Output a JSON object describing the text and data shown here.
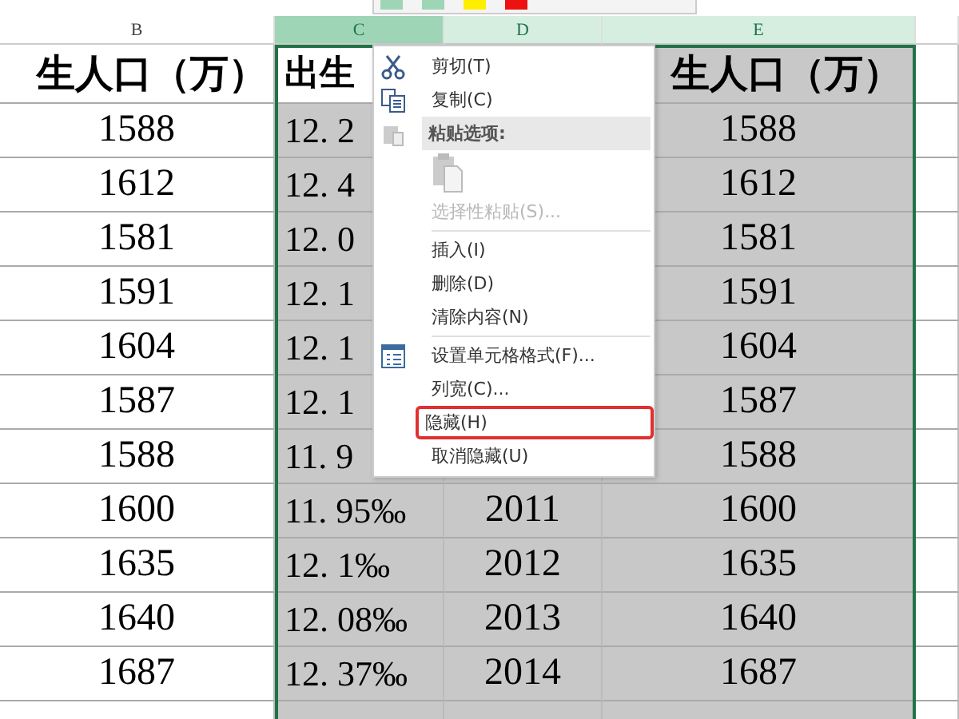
{
  "columns": [
    {
      "label": "B",
      "selected": false,
      "active": false
    },
    {
      "label": "C",
      "selected": true,
      "active": true
    },
    {
      "label": "D",
      "selected": true,
      "active": false
    },
    {
      "label": "E",
      "selected": true,
      "active": false
    }
  ],
  "title_row": {
    "B": "生人口（万）",
    "C": "出生",
    "E": "生人口（万）"
  },
  "rows": [
    {
      "B": "1588",
      "C": "12. 2",
      "E": "1588"
    },
    {
      "B": "1612",
      "C": "12. 4",
      "E": "1612"
    },
    {
      "B": "1581",
      "C": "12. 0",
      "E": "1581"
    },
    {
      "B": "1591",
      "C": "12. 1",
      "E": "1591"
    },
    {
      "B": "1604",
      "C": "12. 1",
      "E": "1604"
    },
    {
      "B": "1587",
      "C": "12. 1",
      "E": "1587"
    },
    {
      "B": "1588",
      "C": "11. 9",
      "E": "1588"
    },
    {
      "B": "1600",
      "C": "11. 95‰",
      "D": "2011",
      "E": "1600"
    },
    {
      "B": "1635",
      "C": "12. 1‰",
      "D": "2012",
      "E": "1635"
    },
    {
      "B": "1640",
      "C": "12. 08‰",
      "D": "2013",
      "E": "1640"
    },
    {
      "B": "1687",
      "C": "12. 37‰",
      "D": "2014",
      "E": "1687"
    }
  ],
  "context_menu": [
    {
      "kind": "command",
      "label": "剪切(T)",
      "disabled": false,
      "highlighted": false
    },
    {
      "kind": "command",
      "label": "复制(C)",
      "disabled": false,
      "highlighted": false
    },
    {
      "kind": "header",
      "label": "粘贴选项:"
    },
    {
      "kind": "paste-options"
    },
    {
      "kind": "command",
      "label": "选择性粘贴(S)...",
      "disabled": true,
      "highlighted": false
    },
    {
      "kind": "divider"
    },
    {
      "kind": "command",
      "label": "插入(I)",
      "disabled": false,
      "highlighted": false
    },
    {
      "kind": "command",
      "label": "删除(D)",
      "disabled": false,
      "highlighted": false
    },
    {
      "kind": "command",
      "label": "清除内容(N)",
      "disabled": false,
      "highlighted": false
    },
    {
      "kind": "divider"
    },
    {
      "kind": "command",
      "label": "设置单元格格式(F)...",
      "disabled": false,
      "highlighted": false
    },
    {
      "kind": "command",
      "label": "列宽(C)...",
      "disabled": false,
      "highlighted": false
    },
    {
      "kind": "command",
      "label": "隐藏(H)",
      "disabled": false,
      "highlighted": true
    },
    {
      "kind": "command",
      "label": "取消隐藏(U)",
      "disabled": false,
      "highlighted": false
    }
  ]
}
